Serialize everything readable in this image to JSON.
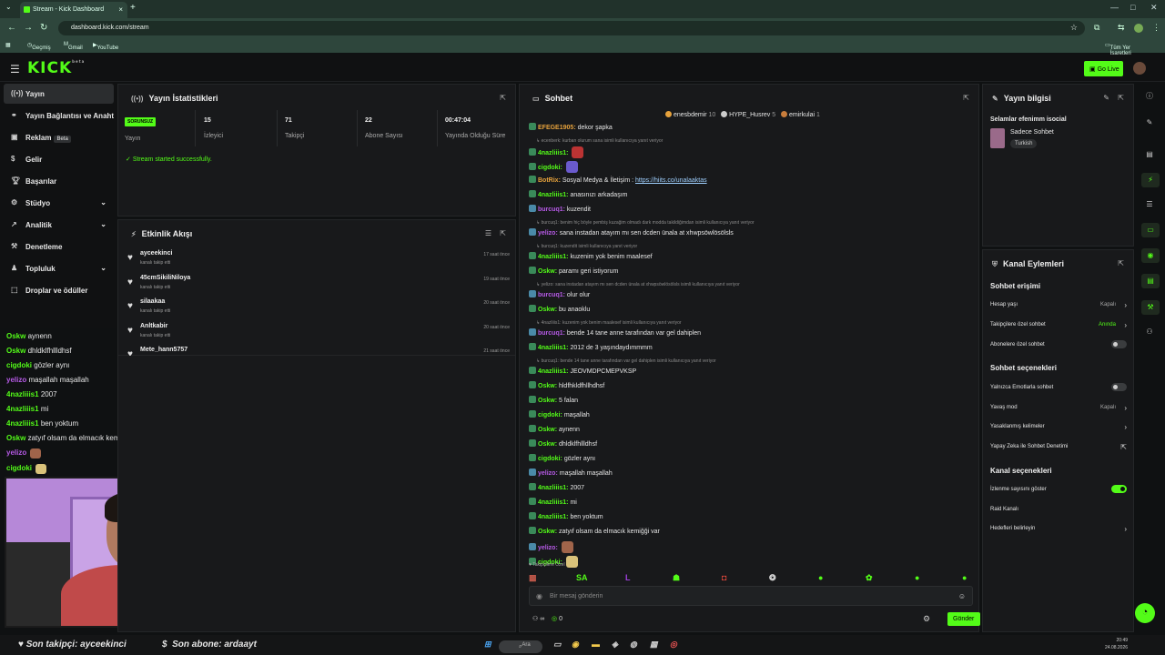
{
  "browser": {
    "tab_title": "Stream - Kick Dashboard",
    "url": "dashboard.kick.com/stream",
    "bookmarks": [
      "Geçmiş",
      "Gmail",
      "YouTube"
    ],
    "all_bookmarks": "Tüm Yer İşaretleri"
  },
  "header": {
    "logo": "KICK",
    "logo_sup": "beta",
    "go_live": "Go Live"
  },
  "sidebar": {
    "items": [
      {
        "label": "Yayın"
      },
      {
        "label": "Yayın Bağlantısı ve Anahtarı"
      },
      {
        "label": "Reklam",
        "badge": "Beta"
      },
      {
        "label": "Gelir"
      },
      {
        "label": "Başarılar"
      },
      {
        "label": "Stüdyo"
      },
      {
        "label": "Analitik"
      },
      {
        "label": "Denetleme"
      },
      {
        "label": "Topluluk"
      },
      {
        "label": "Droplar ve ödüller"
      }
    ]
  },
  "stats": {
    "title": "Yayın İstatistikleri",
    "status_badge": "SORUNSUZ",
    "status_label": "Yayın",
    "viewers": "15",
    "viewers_label": "İzleyici",
    "followers": "71",
    "followers_label": "Takipçi",
    "subs": "22",
    "subs_label": "Abone Sayısı",
    "duration": "00:47:04",
    "duration_label": "Yayında Olduğu Süre",
    "success": "Stream started successfully."
  },
  "activity": {
    "title": "Etkinlik Akışı",
    "events": [
      {
        "name": "ayceekinci",
        "sub": "kanalı takip etti",
        "time": "17 saat önce"
      },
      {
        "name": "45cmSikiliNiloya",
        "sub": "kanalı takip etti",
        "time": "19 saat önce"
      },
      {
        "name": "silaakaa",
        "sub": "kanalı takip etti",
        "time": "20 saat önce"
      },
      {
        "name": "Anltkabir",
        "sub": "kanalı takip etti",
        "time": "20 saat önce"
      },
      {
        "name": "Mete_hann5757",
        "sub": "kanalı takip etti",
        "time": "21 saat önce"
      }
    ]
  },
  "chat": {
    "title": "Sohbet",
    "top": [
      {
        "name": "enesbdemir",
        "n": "10"
      },
      {
        "name": "HYPE_Husrev",
        "n": "5"
      },
      {
        "name": "emirkulai",
        "n": "1"
      }
    ],
    "followers_only_label": "Takipçilere Özel",
    "input_placeholder": "Bir mesaj gönderin",
    "send": "Gönder",
    "footer_count1": "∞",
    "footer_count2": "0",
    "messages": [
      {
        "type": "msg",
        "user": "EFEGE1905",
        "text": "dekor şapka",
        "color": "#e6a23c"
      },
      {
        "type": "reply",
        "text": "ecenberk: kurban olurum sana isimli kullanıcıya yanıt veriyor"
      },
      {
        "type": "msg",
        "user": "4nazliiis1",
        "text": "",
        "color": "#53fc18",
        "emote": "#b33"
      },
      {
        "type": "msg",
        "user": "cigdoki",
        "text": "",
        "color": "#53fc18",
        "emote": "#6a5acd"
      },
      {
        "type": "msg",
        "user": "BotRix",
        "text": "Sosyal Medya & İletişim : ",
        "link": "https://hiits.co/unalaaktas",
        "color": "#e6a23c"
      },
      {
        "type": "msg",
        "user": "4nazliiis1",
        "text": "anasınızı arkadaşım",
        "color": "#53fc18"
      },
      {
        "type": "msg",
        "user": "burcuq1",
        "text": "kuzendit",
        "color": "#b65ae6"
      },
      {
        "type": "reply",
        "text": "burcuq1: benim hiç böyle pembiş kuzağim olmadı dark modda takildiğimdan isimli kullanıcıya yanıt veriyor"
      },
      {
        "type": "msg",
        "user": "yelizo",
        "text": "sana instadan atayım mı sen dcden ünala at xhwpsöwlösölsls",
        "color": "#b65ae6"
      },
      {
        "type": "reply",
        "text": "burcuq1: kuzendit isimli kullanıcıya yanıt veriyor"
      },
      {
        "type": "msg",
        "user": "4nazliiis1",
        "text": "kuzenim yok benim maalesef",
        "color": "#53fc18"
      },
      {
        "type": "msg",
        "user": "Oskw",
        "text": "paramı geri istiyorum",
        "color": "#53fc18"
      },
      {
        "type": "reply",
        "text": "yelizo: sana instadan atayım mı sen dcden ünala at xhwpsöwlösölsls isimli kullanıcıya yanıt veriyor"
      },
      {
        "type": "msg",
        "user": "burcuq1",
        "text": "olur olur",
        "color": "#b65ae6"
      },
      {
        "type": "msg",
        "user": "Oskw",
        "text": "bu anaoklu",
        "color": "#53fc18"
      },
      {
        "type": "reply",
        "text": "4nazliiis1: kuzenim yok benim maalesef isimli kullanıcıya yanıt veriyor"
      },
      {
        "type": "msg",
        "user": "burcuq1",
        "text": "bende 14 tane anne tarafından var gel dahiplen",
        "color": "#b65ae6"
      },
      {
        "type": "msg",
        "user": "4nazliiis1",
        "text": "2012 de 3 yaşındaydımmmm",
        "color": "#53fc18"
      },
      {
        "type": "reply",
        "text": "burcuq1: bende 14 tane anne tarafından var gel dahiplen isimli kullanıcıya yanıt veriyor"
      },
      {
        "type": "msg",
        "user": "4nazliiis1",
        "text": "JEOVMDPCMEPVKSP",
        "color": "#53fc18"
      },
      {
        "type": "msg",
        "user": "Oskw",
        "text": "hldfhkldfhllhdhsf",
        "color": "#53fc18"
      },
      {
        "type": "msg",
        "user": "Oskw",
        "text": "5 falan",
        "color": "#53fc18"
      },
      {
        "type": "msg",
        "user": "cigdoki",
        "text": "maşallah",
        "color": "#53fc18"
      },
      {
        "type": "msg",
        "user": "Oskw",
        "text": "aynenn",
        "color": "#53fc18"
      },
      {
        "type": "msg",
        "user": "Oskw",
        "text": "dhldklfhllldhsf",
        "color": "#53fc18"
      },
      {
        "type": "msg",
        "user": "cigdoki",
        "text": "gözler aynı",
        "color": "#53fc18"
      },
      {
        "type": "msg",
        "user": "yelizo",
        "text": "maşallah maşallah",
        "color": "#b65ae6"
      },
      {
        "type": "msg",
        "user": "4nazliiis1",
        "text": "2007",
        "color": "#53fc18"
      },
      {
        "type": "msg",
        "user": "4nazliiis1",
        "text": "mi",
        "color": "#53fc18"
      },
      {
        "type": "msg",
        "user": "4nazliiis1",
        "text": "ben yoktum",
        "color": "#53fc18"
      },
      {
        "type": "msg",
        "user": "Oskw",
        "text": "zatyıf olsam da elmacık kemiğği var",
        "color": "#53fc18"
      },
      {
        "type": "msg",
        "user": "yelizo",
        "text": "",
        "color": "#b65ae6",
        "emote": "#a0644a"
      },
      {
        "type": "msg",
        "user": "cigdoki",
        "text": "",
        "color": "#53fc18",
        "emote": "#d9c27a"
      }
    ]
  },
  "overlay_chat": [
    {
      "user": "Oskw",
      "text": "aynenn",
      "color": "#53fc18"
    },
    {
      "user": "Oskw",
      "text": "dhldklfhllldhsf",
      "color": "#53fc18"
    },
    {
      "user": "cigdoki",
      "text": "gözler aynı",
      "color": "#53fc18"
    },
    {
      "user": "yelizo",
      "text": "maşallah maşallah",
      "color": "#b65ae6"
    },
    {
      "user": "4nazliiis1",
      "text": "2007",
      "color": "#53fc18"
    },
    {
      "user": "4nazliiis1",
      "text": "mi",
      "color": "#53fc18"
    },
    {
      "user": "4nazliiis1",
      "text": "ben yoktum",
      "color": "#53fc18"
    },
    {
      "user": "Oskw",
      "text": "zatyıf olsam da elmacık kemiğği var",
      "color": "#53fc18"
    },
    {
      "user": "yelizo",
      "text": "",
      "color": "#b65ae6",
      "emote": "#a0644a"
    },
    {
      "user": "cigdoki",
      "text": "",
      "color": "#53fc18",
      "emote": "#d9c27a"
    }
  ],
  "overlay_bar": {
    "last_follower": "Son takipçi: ayceekinci",
    "last_sub": "Son abone: ardaayt"
  },
  "stream_info": {
    "title": "Yayın bilgisi",
    "stream_title": "Selamlar efenimm isocial",
    "category": "Sadece Sohbet",
    "language": "Turkish"
  },
  "channel_actions": {
    "title": "Kanal Eylemleri",
    "chat_access": "Sohbet erişimi",
    "account_age": "Hesap yaşı",
    "account_age_value": "Kapalı",
    "followers_only": "Takipçilere özel sohbet",
    "followers_only_value": "Anında",
    "subs_only": "Abonelere özel sohbet",
    "chat_options": "Sohbet seçenekleri",
    "emotes_only": "Yalnızca Emotlarla sohbet",
    "slow_mode": "Yavaş mod",
    "slow_mode_value": "Kapalı",
    "banned_words": "Yasaklanmış kelimeler",
    "ai_moderation": "Yapay Zeka ile Sohbet Denetimi",
    "channel_options": "Kanal seçenekleri",
    "show_viewers": "İzlenme sayısını göster",
    "raid": "Raid Kanalı",
    "goals": "Hedefleri belirleyin"
  },
  "taskbar": {
    "search": "Ara",
    "time": "20:49",
    "date": "24.08.2026"
  },
  "colors": {
    "accent": "#53fc18",
    "panel": "#18191b",
    "bg": "#0f1112"
  }
}
